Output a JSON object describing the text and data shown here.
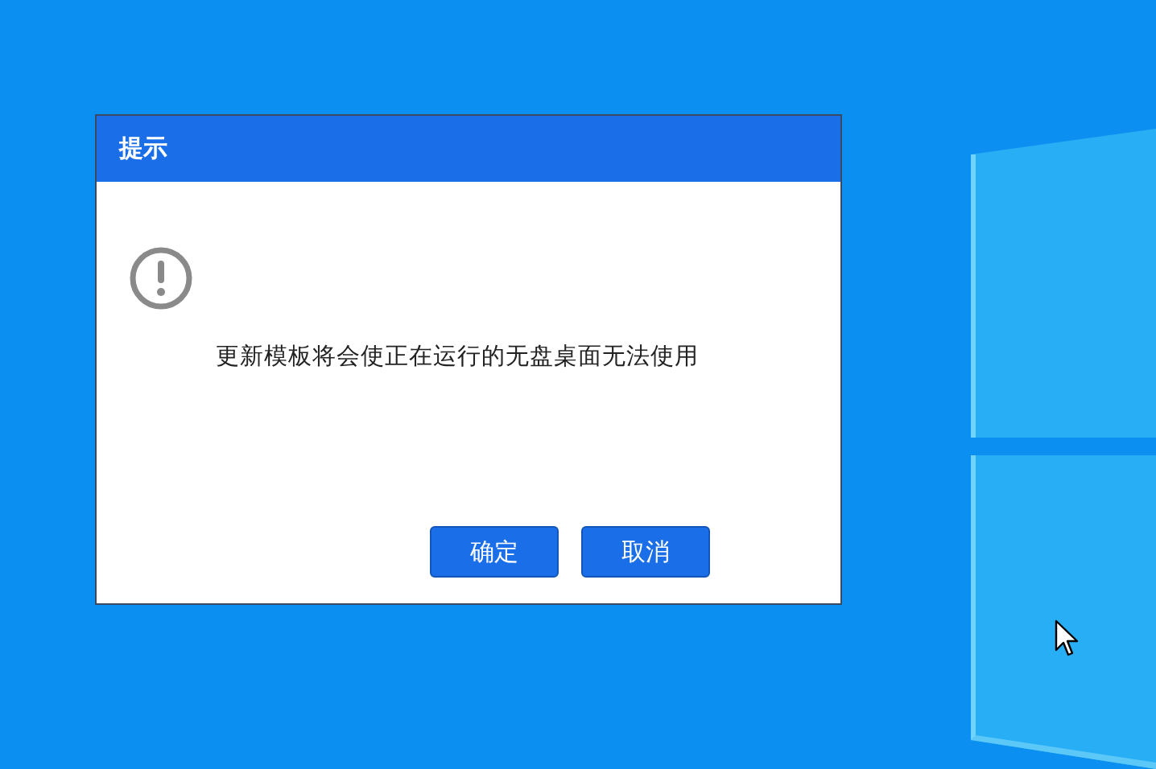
{
  "dialog": {
    "title": "提示",
    "message": "更新模板将会使正在运行的无盘桌面无法使用",
    "buttons": [
      "确定",
      "取消"
    ]
  }
}
